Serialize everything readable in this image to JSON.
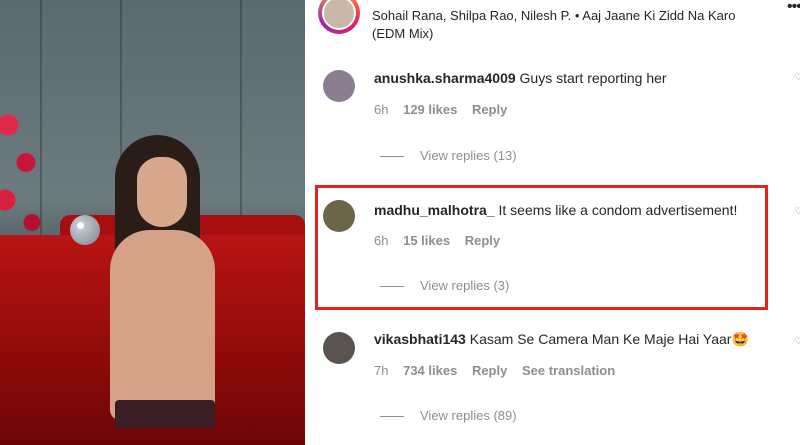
{
  "header": {
    "text": "Sohail Rana, Shilpa Rao, Nilesh P. • Aaj Jaane Ki Zidd Na Karo (EDM Mix)"
  },
  "comments": [
    {
      "username": "anushka.sharma4009",
      "text": "Guys start reporting her",
      "time": "6h",
      "likes": "129 likes",
      "reply": "Reply",
      "view_replies": "View replies (13)",
      "avatar_color": "#8a7d8f"
    },
    {
      "username": "madhu_malhotra_",
      "text": "It seems like a condom advertisement!",
      "time": "6h",
      "likes": "15 likes",
      "reply": "Reply",
      "view_replies": "View replies (3)",
      "avatar_color": "#6d6548"
    },
    {
      "username": "vikasbhati143",
      "text": "Kasam Se Camera Man Ke Maje Hai Yaar🤩",
      "time": "7h",
      "likes": "734 likes",
      "reply": "Reply",
      "see_translation": "See translation",
      "view_replies": "View replies (89)",
      "avatar_color": "#5b5350"
    }
  ],
  "icons": {
    "more": "more-options-icon",
    "like": "heart-icon"
  },
  "colors": {
    "highlight_border": "#e02424",
    "muted_text": "#8e8e8e"
  }
}
